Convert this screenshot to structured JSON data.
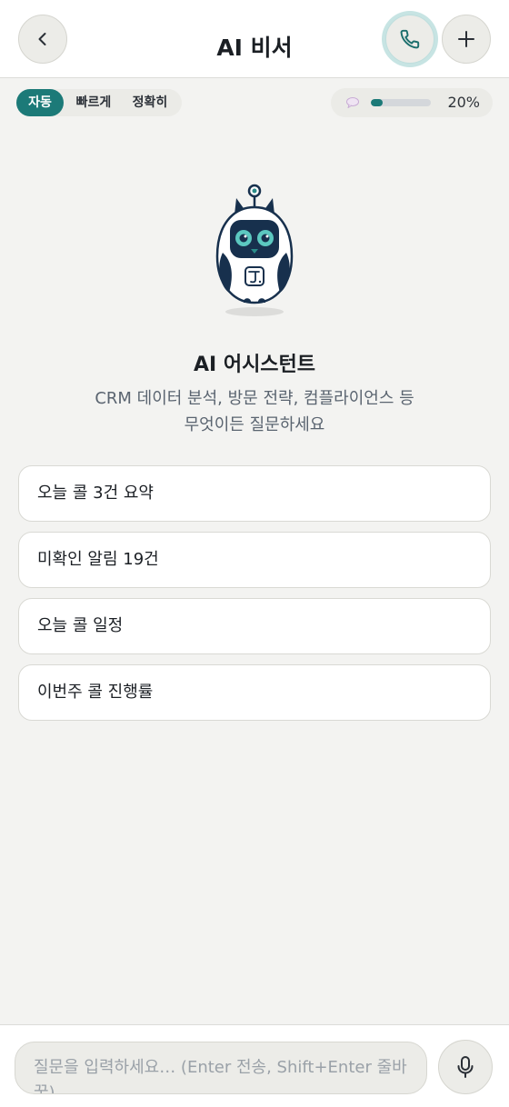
{
  "header": {
    "title": "AI 비서",
    "back_icon": "chevron-left-icon",
    "call_icon": "phone-icon",
    "plus_icon": "plus-icon"
  },
  "modes": {
    "items": [
      {
        "label": "자동",
        "active": true
      },
      {
        "label": "빠르게",
        "active": false
      },
      {
        "label": "정확히",
        "active": false
      }
    ]
  },
  "usage": {
    "icon": "chat-bubble-icon",
    "percent_label": "20%",
    "percent_value": 20
  },
  "assistant": {
    "title": "AI 어시스턴트",
    "subtitle_line1": "CRM 데이터 분석, 방문 전략, 컴플라이언스 등",
    "subtitle_line2": "무엇이든 질문하세요"
  },
  "suggestions": [
    {
      "label": "오늘 콜 3건 요약"
    },
    {
      "label": "미확인 알림 19건"
    },
    {
      "label": "오늘 콜 일정"
    },
    {
      "label": "이번주 콜 진행률"
    }
  ],
  "composer": {
    "placeholder": "질문을 입력하세요… (Enter 전송, Shift+Enter 줄바꿈)",
    "value": "",
    "mic_icon": "microphone-icon"
  },
  "colors": {
    "accent": "#1c7a78",
    "background": "#f3f3f1",
    "mascot_navy": "#17304d",
    "mascot_eye": "#5cc8c0"
  }
}
